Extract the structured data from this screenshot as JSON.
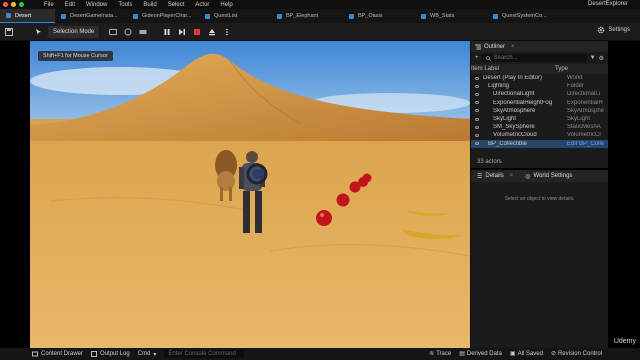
{
  "menubar": {
    "items": [
      "File",
      "Edit",
      "Window",
      "Tools",
      "Build",
      "Select",
      "Actor",
      "Help"
    ],
    "app_title": "DesertExplorer"
  },
  "tabs": [
    {
      "label": "Desert",
      "active": true
    },
    {
      "label": "DesertGameInsta...",
      "active": false
    },
    {
      "label": "GideonPlayerChar...",
      "active": false
    },
    {
      "label": "QuestList",
      "active": false
    },
    {
      "label": "BP_Elephant",
      "active": false
    },
    {
      "label": "BP_Oasis",
      "active": false
    },
    {
      "label": "WB_Stats",
      "active": false
    },
    {
      "label": "QuestSystemCo...",
      "active": false
    }
  ],
  "toolbar": {
    "mode_label": "Selection Mode",
    "settings_label": "Settings"
  },
  "viewport": {
    "hint": "Shift+F1 for Mouse Cursor"
  },
  "outliner": {
    "title": "Outliner",
    "search_placeholder": "Search...",
    "col_label": "Item Label",
    "col_type": "Type",
    "rows": [
      {
        "label": "Desert (Play In Editor)",
        "type": "World",
        "indent": 0
      },
      {
        "label": "Lighting",
        "type": "Folder",
        "indent": 1
      },
      {
        "label": "DirectionalLight",
        "type": "DirectionalLi",
        "indent": 2
      },
      {
        "label": "ExponentialHeightFog",
        "type": "ExponentialH",
        "indent": 2
      },
      {
        "label": "SkyAtmosphere",
        "type": "SkyAtmosphe",
        "indent": 2
      },
      {
        "label": "SkyLight",
        "type": "SkyLight",
        "indent": 2
      },
      {
        "label": "SM_SkySphere",
        "type": "StaticMeshA",
        "indent": 2
      },
      {
        "label": "VolumetricCloud",
        "type": "VolumetricCl",
        "indent": 2
      },
      {
        "label": "BP_Collectible",
        "type": "Edit BP_Colle",
        "indent": 1
      }
    ],
    "actor_count": "33 actors"
  },
  "details": {
    "tab_details": "Details",
    "tab_world": "World Settings",
    "empty_text": "Select an object to view details."
  },
  "statusbar": {
    "content_drawer": "Content Drawer",
    "output_log": "Output Log",
    "cmd": "Cmd",
    "console_placeholder": "Enter Console Command",
    "trace": "Trace",
    "derived_data": "Derived Data",
    "all_saved": "All Saved",
    "revision_control": "Revision Control"
  },
  "watermark": "Udemy",
  "colors": {
    "accent": "#1e90ff",
    "sky": "#3f8fe0",
    "sand": "#e0a040"
  }
}
